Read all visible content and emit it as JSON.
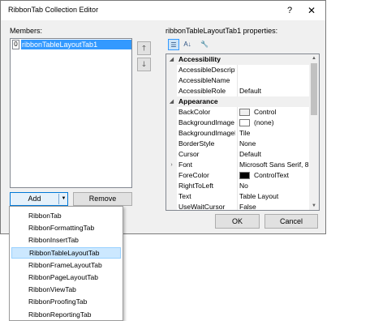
{
  "window": {
    "title": "RibbonTab Collection Editor",
    "help": "?",
    "close": "✕"
  },
  "members": {
    "label": "Members:",
    "items": [
      {
        "index": "0",
        "name": "ribbonTableLayoutTab1"
      }
    ]
  },
  "move_up_icon": "🡑",
  "move_down_icon": "🡓",
  "properties": {
    "label": "ribbonTableLayoutTab1 properties:",
    "toolbar": {
      "categorized": "☰",
      "alphabetical": "A↓",
      "property_pages": "🔧"
    },
    "rows": [
      {
        "type": "category",
        "margin": "▲",
        "name": "Accessibility"
      },
      {
        "type": "prop",
        "name": "AccessibleDescript",
        "value": ""
      },
      {
        "type": "prop",
        "name": "AccessibleName",
        "value": ""
      },
      {
        "type": "prop",
        "name": "AccessibleRole",
        "value": "Default"
      },
      {
        "type": "category",
        "margin": "▲",
        "name": "Appearance"
      },
      {
        "type": "prop",
        "name": "BackColor",
        "value": "Control",
        "swatch": "#f0f0f0"
      },
      {
        "type": "prop",
        "name": "BackgroundImage",
        "value": "(none)",
        "swatch": "#ffffff"
      },
      {
        "type": "prop",
        "name": "BackgroundImageL",
        "value": "Tile"
      },
      {
        "type": "prop",
        "name": "BorderStyle",
        "value": "None"
      },
      {
        "type": "prop",
        "name": "Cursor",
        "value": "Default"
      },
      {
        "type": "prop",
        "margin": ">",
        "name": "Font",
        "value": "Microsoft Sans Serif, 8.2"
      },
      {
        "type": "prop",
        "name": "ForeColor",
        "value": "ControlText",
        "swatch": "#000000"
      },
      {
        "type": "prop",
        "name": "RightToLeft",
        "value": "No"
      },
      {
        "type": "prop",
        "name": "Text",
        "value": "Table Layout"
      },
      {
        "type": "prop",
        "name": "UseWaitCursor",
        "value": "False"
      }
    ]
  },
  "buttons": {
    "add": "Add",
    "remove": "Remove",
    "ok": "OK",
    "cancel": "Cancel"
  },
  "add_menu": {
    "items": [
      "RibbonTab",
      "RibbonFormattingTab",
      "RibbonInsertTab",
      "RibbonTableLayoutTab",
      "RibbonFrameLayoutTab",
      "RibbonPageLayoutTab",
      "RibbonViewTab",
      "RibbonProofingTab",
      "RibbonReportingTab"
    ],
    "highlighted_index": 3
  },
  "colors": {
    "selection": "#3399ff",
    "menu_highlight": "#cce8ff",
    "dialog_bg": "#f0f0f0"
  }
}
